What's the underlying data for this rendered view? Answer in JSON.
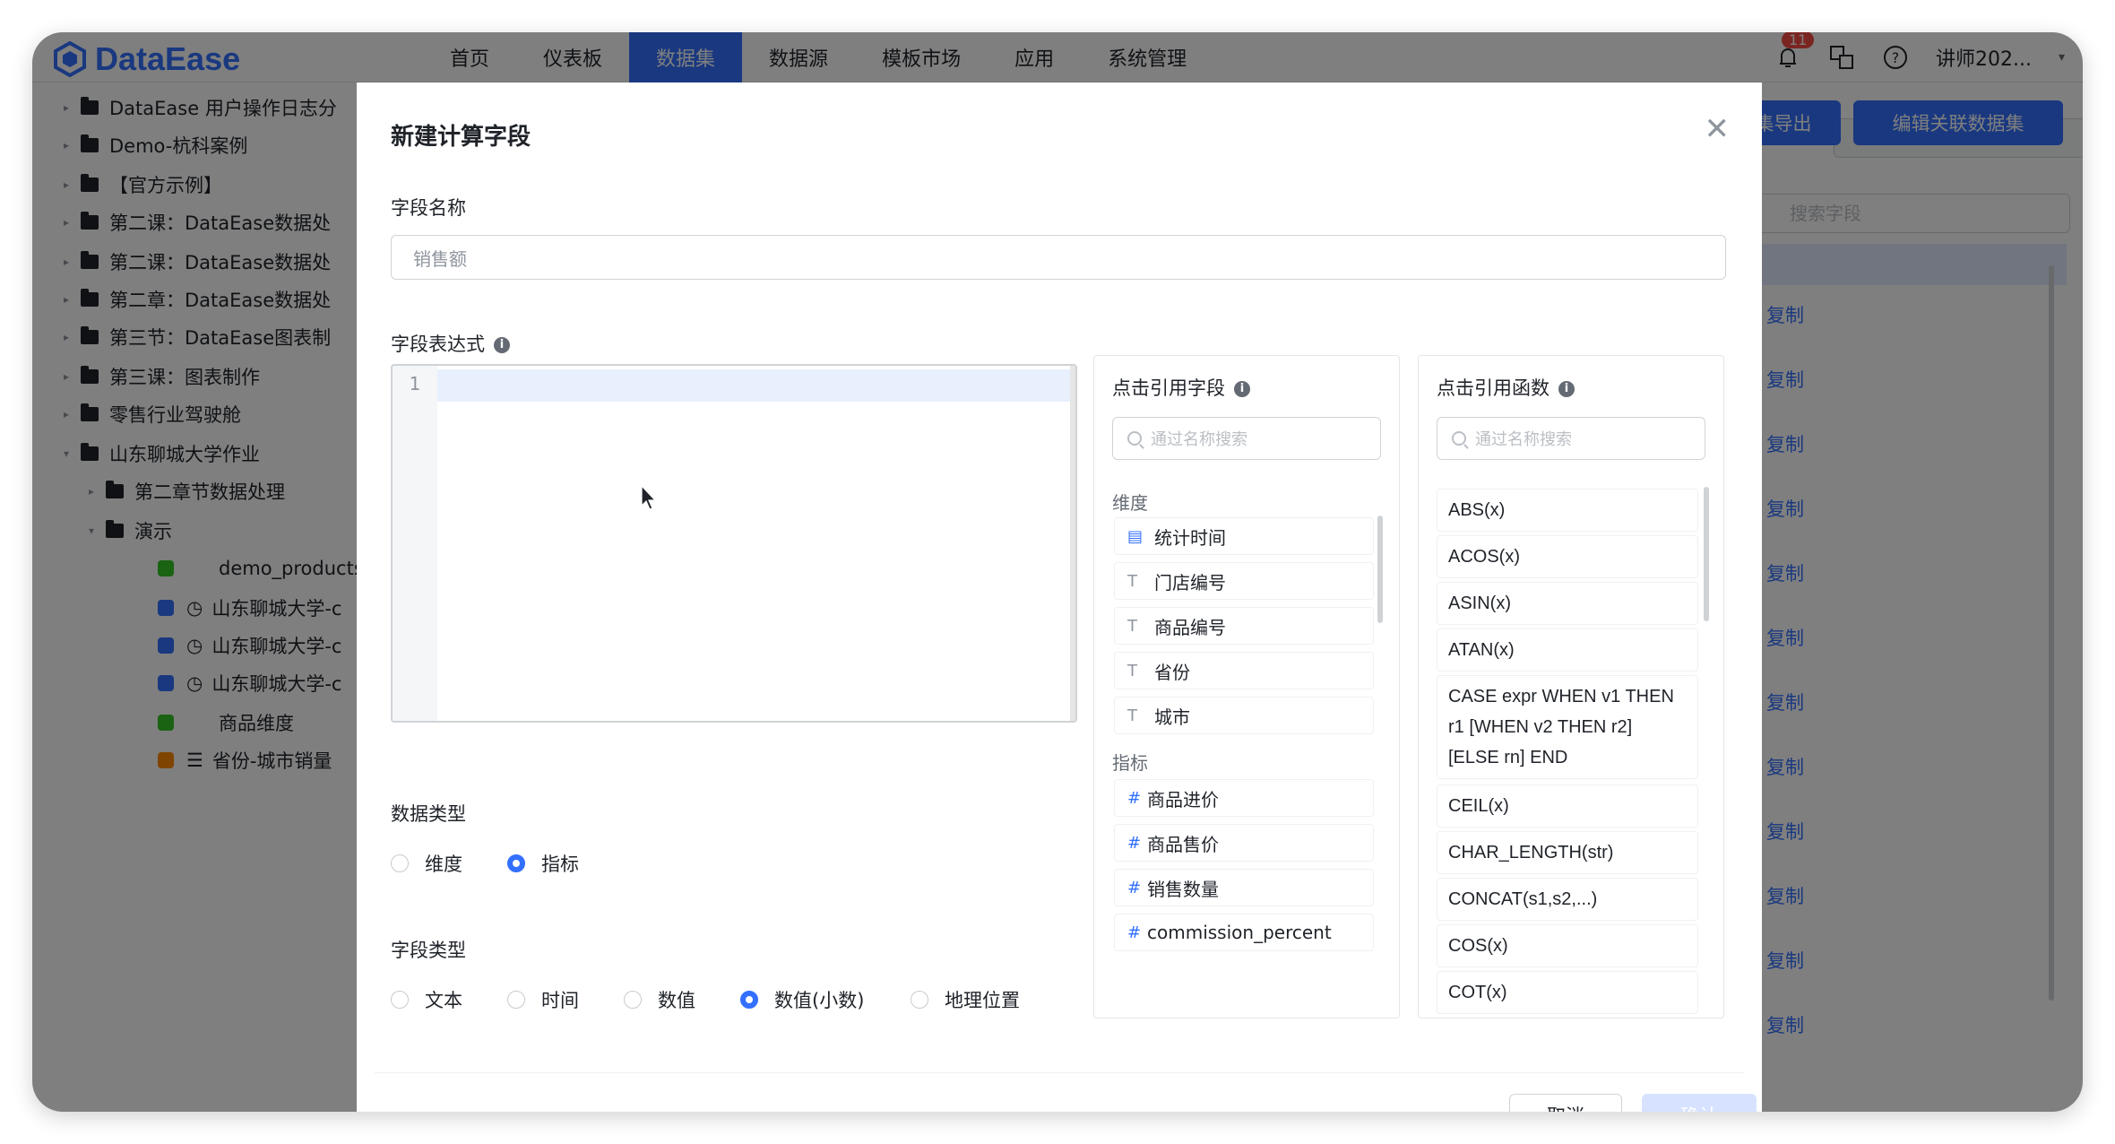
{
  "app": {
    "logo": "DataEase",
    "brand_color": "#3370ff"
  },
  "nav": [
    "首页",
    "仪表板",
    "数据集",
    "数据源",
    "模板市场",
    "应用",
    "系统管理"
  ],
  "nav_active": "数据集",
  "header": {
    "notification_count": "11",
    "user": "讲师202..."
  },
  "tree": [
    "DataEase 用户操作日志分",
    "Demo-杭科案例",
    "【官方示例】",
    "第二课：DataEase数据处",
    "第二课：DataEase数据处",
    "第二章：DataEase数据处",
    "第三节：DataEase图表制",
    "第三课：图表制作",
    "零售行业驾驶舱",
    "山东聊城大学作业",
    "第二章节数据处理",
    "演示",
    "demo_products",
    "山东聊城大学-c",
    "山东聊城大学-c",
    "山东聊城大学-c",
    "商品维度",
    "省份-城市销量"
  ],
  "main": {
    "export_btn": "集导出",
    "edit_btn": "编辑关联数据集",
    "search_placeholder": "搜索字段",
    "copy": "复制"
  },
  "dialog": {
    "title": "新建计算字段",
    "field_name_label": "字段名称",
    "field_name_value": "销售额",
    "expression_label": "字段表达式",
    "line_number": "1",
    "data_type_label": "数据类型",
    "data_type_options": [
      "维度",
      "指标"
    ],
    "data_type_selected": "指标",
    "field_type_label": "字段类型",
    "field_type_options": [
      "文本",
      "时间",
      "数值",
      "数值(小数)",
      "地理位置"
    ],
    "field_type_selected": "数值(小数)",
    "cancel": "取消",
    "confirm": "确认"
  },
  "fields_panel": {
    "title": "点击引用字段",
    "search_placeholder": "通过名称搜索",
    "dimension_title": "维度",
    "dimensions": [
      "统计时间",
      "门店编号",
      "商品编号",
      "省份",
      "城市"
    ],
    "measure_title": "指标",
    "measures": [
      "商品进价",
      "商品售价",
      "销售数量",
      "commission_percent"
    ]
  },
  "functions_panel": {
    "title": "点击引用函数",
    "search_placeholder": "通过名称搜索",
    "functions": [
      "ABS(x)",
      "ACOS(x)",
      "ASIN(x)",
      "ATAN(x)",
      "CASE expr WHEN v1 THEN r1 [WHEN v2 THEN r2] [ELSE rn] END",
      "CEIL(x)",
      "CHAR_LENGTH(str)",
      "CONCAT(s1,s2,...)",
      "COS(x)",
      "COT(x)"
    ]
  }
}
